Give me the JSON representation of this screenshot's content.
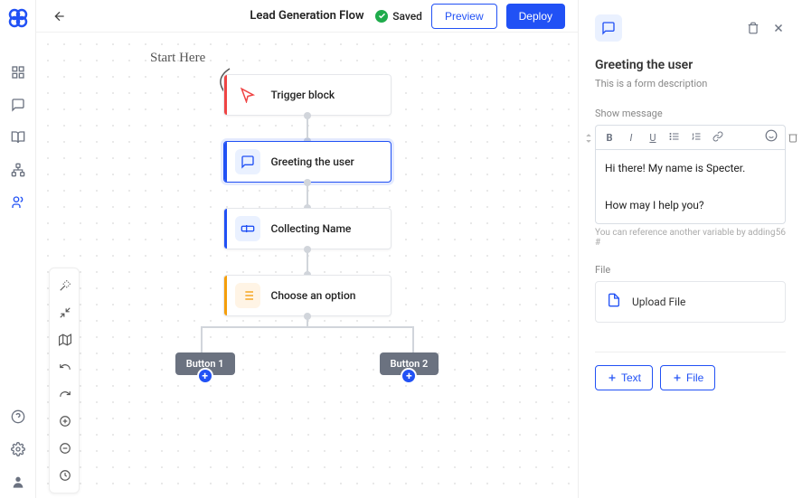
{
  "header": {
    "title": "Lead Generation Flow",
    "saved": "Saved",
    "preview": "Preview",
    "deploy": "Deploy"
  },
  "flow": {
    "start_label": "Start Here",
    "nodes": [
      {
        "label": "Trigger block",
        "color": "red"
      },
      {
        "label": "Greeting the user",
        "color": "blue"
      },
      {
        "label": "Collecting Name",
        "color": "blue"
      },
      {
        "label": "Choose an option",
        "color": "orange"
      }
    ],
    "buttons": [
      {
        "label": "Button 1"
      },
      {
        "label": "Button 2"
      }
    ]
  },
  "panel": {
    "title": "Greeting the user",
    "description": "This is a form description",
    "show_message_label": "Show message",
    "message": "Hi there! My name is Specter.\n\nHow may I help you?",
    "hint": "You can reference another variable by adding #",
    "char_count": "56",
    "file_label": "File",
    "upload_label": "Upload File",
    "add_text": "Text",
    "add_file": "File"
  }
}
